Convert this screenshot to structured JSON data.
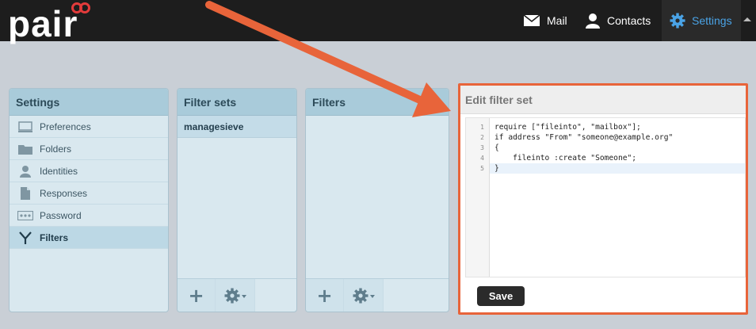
{
  "brand": {
    "logo_text": "pair"
  },
  "nav": {
    "items": [
      {
        "label": "Mail",
        "icon": "mail-icon"
      },
      {
        "label": "Contacts",
        "icon": "person-icon"
      },
      {
        "label": "Settings",
        "icon": "gear-icon",
        "active": true
      }
    ]
  },
  "settings_panel": {
    "title": "Settings",
    "items": [
      {
        "label": "Preferences",
        "icon": "monitor-icon"
      },
      {
        "label": "Folders",
        "icon": "folder-icon"
      },
      {
        "label": "Identities",
        "icon": "person-icon"
      },
      {
        "label": "Responses",
        "icon": "document-icon"
      },
      {
        "label": "Password",
        "icon": "password-icon"
      },
      {
        "label": "Filters",
        "icon": "filter-icon",
        "selected": true
      }
    ]
  },
  "filtersets_panel": {
    "title": "Filter sets",
    "items": [
      {
        "label": "managesieve",
        "selected": true
      }
    ]
  },
  "filters_panel": {
    "title": "Filters"
  },
  "edit_panel": {
    "title": "Edit filter set",
    "line_numbers": [
      "1",
      "2",
      "3",
      "4",
      "5"
    ],
    "code_lines": [
      "require [\"fileinto\", \"mailbox\"];",
      "if address \"From\" \"someone@example.org\"",
      "{",
      "    fileinto :create \"Someone\";",
      "}"
    ],
    "save_label": "Save"
  },
  "colors": {
    "accent_blue": "#4aa3e6",
    "annotation_orange": "#e8643a",
    "topbar": "#1d1d1d",
    "panel_header": "#a9cbda"
  }
}
